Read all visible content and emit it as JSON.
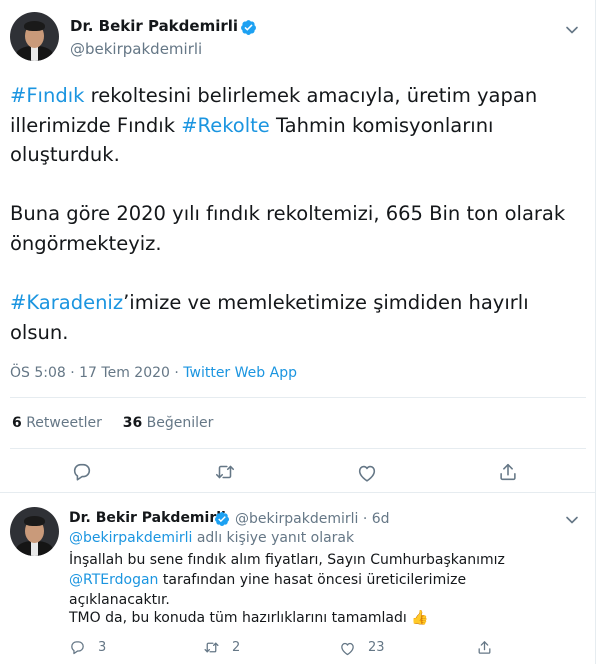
{
  "tweet": {
    "author_name": "Dr. Bekir Pakdemirli",
    "author_handle": "@bekirpakdemirli",
    "hashtag_findik": "#Fındık",
    "text_1a": " rekoltesini belirlemek amacıyla, üretim yapan illerimizde Fındık ",
    "hashtag_rekolte": "#Rekolte",
    "text_1b": " Tahmin komisyonlarını oluşturduk.",
    "text_2": "Buna göre 2020 yılı fındık rekoltemizi, 665 Bin ton olarak öngörmekteyiz.",
    "hashtag_karadeniz": "#Karadeniz",
    "text_3": "’imize ve memleketimize şimdiden hayırlı olsun.",
    "timestamp": "ÖS 5:08 · 17 Tem 2020 · ",
    "source": "Twitter Web App",
    "retweets_count": "6",
    "retweets_label": " Retweetler",
    "likes_count": "36",
    "likes_label": " Beğeniler"
  },
  "reply": {
    "author_name": "Dr. Bekir Pakdemirli",
    "author_handle": "@bekirpakdemirli",
    "separator": " · ",
    "age": "6d",
    "replying_to": "@bekirpakdemirli",
    "replying_suffix": " adlı kişiye yanıt olarak",
    "text_1a": "İnşallah bu sene fındık alım fiyatları, Sayın Cumhurbaşkanımız ",
    "mention_erdogan": "@RTErdogan",
    "text_1b": " tarafından yine hasat öncesi üreticilerimize açıklanacaktır.",
    "text_2": "TMO da, bu konuda tüm hazırlıklarını tamamladı ",
    "emoji": "👍",
    "reply_count": "3",
    "retweet_count": "2",
    "like_count": "23"
  },
  "colors": {
    "accent": "#1b95e0",
    "muted": "#657786",
    "text": "#14171a",
    "divider": "#e6ecf0"
  },
  "icons": {
    "verified": "verified-badge-icon",
    "more": "chevron-down-icon",
    "reply": "reply-icon",
    "retweet": "retweet-icon",
    "like": "heart-icon",
    "share": "share-icon"
  }
}
